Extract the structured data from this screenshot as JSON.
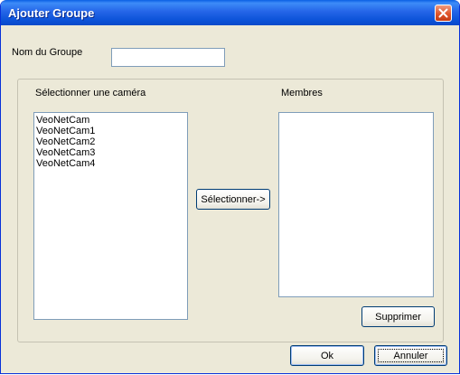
{
  "window": {
    "title": "Ajouter Groupe"
  },
  "group_name": {
    "label": "Nom du Groupe",
    "value": ""
  },
  "camera_list": {
    "label": "Sélectionner une caméra",
    "items": [
      "VeoNetCam",
      "VeoNetCam1",
      "VeoNetCam2",
      "VeoNetCam3",
      "VeoNetCam4"
    ]
  },
  "members_list": {
    "label": "Membres",
    "items": []
  },
  "buttons": {
    "select": "Sélectionner->",
    "remove": "Supprimer",
    "ok": "Ok",
    "cancel": "Annuler"
  },
  "icons": {
    "close": "close-icon"
  },
  "colors": {
    "title_bar": "#0a5fe4",
    "close_button": "#e0552a",
    "window_bg": "#ece9d8"
  }
}
